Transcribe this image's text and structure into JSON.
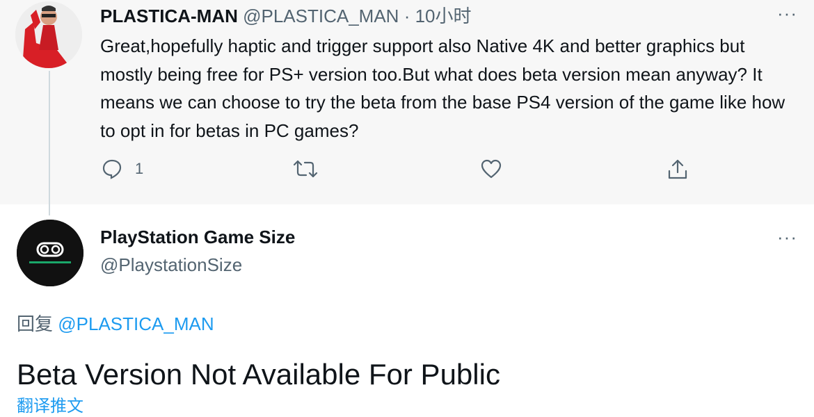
{
  "parent_tweet": {
    "display_name": "PLASTICA-MAN",
    "handle": "@PLASTICA_MAN",
    "separator": "·",
    "time": "10小时",
    "more": "···",
    "text": "Great,hopefully haptic and trigger support also Native 4K and better graphics but mostly being free for PS+ version too.But what does beta version mean anyway? It means we can choose to try the beta from the base PS4 version of the game like how to opt in for betas in PC games?",
    "actions": {
      "reply_count": "1",
      "reply_icon": "reply-icon",
      "retweet_icon": "retweet-icon",
      "like_icon": "like-icon",
      "share_icon": "share-icon"
    }
  },
  "reply_tweet": {
    "display_name": "PlayStation Game Size",
    "handle": "@PlaystationSize",
    "more": "···",
    "reply_prefix": "回复",
    "reply_mention": "@PLASTICA_MAN",
    "text": "Beta Version Not Available For Public",
    "translate": "翻译推文"
  },
  "colors": {
    "accent": "#1d9bf0",
    "secondary_text": "#536471",
    "parent_bg": "#f7f7f7"
  }
}
